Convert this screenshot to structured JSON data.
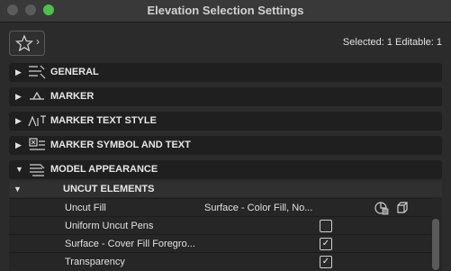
{
  "window": {
    "title": "Elevation Selection Settings"
  },
  "toolbar": {
    "favorites_chevron": "›",
    "selection_info": "Selected: 1 Editable: 1"
  },
  "sections": [
    {
      "label": "GENERAL",
      "arrow": "▶"
    },
    {
      "label": "MARKER",
      "arrow": "▶"
    },
    {
      "label": "MARKER TEXT STYLE",
      "arrow": "▶"
    },
    {
      "label": "MARKER SYMBOL AND TEXT",
      "arrow": "▶"
    },
    {
      "label": "MODEL APPEARANCE",
      "arrow": "▼"
    }
  ],
  "model_appearance": {
    "subsection": {
      "label": "UNCUT ELEMENTS",
      "arrow": "▼"
    },
    "rows": [
      {
        "name": "Uncut Fill",
        "value": "Surface - Color Fill, No..."
      },
      {
        "name": "Uniform Uncut Pens",
        "checked": false
      },
      {
        "name": "Surface - Cover Fill Foregro...",
        "checked": true,
        "mark": "✓"
      },
      {
        "name": "Transparency",
        "checked": true,
        "mark": "✓"
      }
    ]
  },
  "colors": {
    "accent_green": "#4cc14a",
    "panel_bg": "#2b2b2b",
    "section_bg": "#1f1f1f"
  }
}
